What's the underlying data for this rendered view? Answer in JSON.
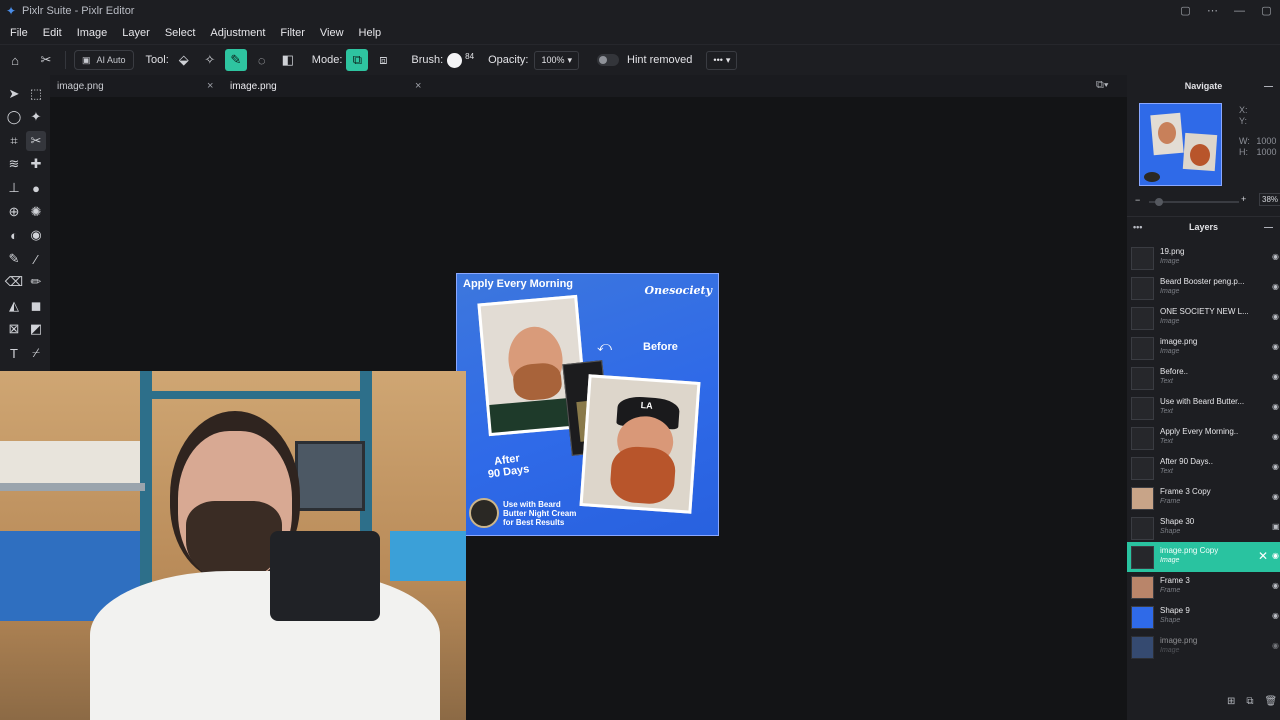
{
  "window": {
    "title": "Pixlr Suite - Pixlr Editor"
  },
  "menu": [
    "File",
    "Edit",
    "Image",
    "Layer",
    "Select",
    "Adjustment",
    "Filter",
    "View",
    "Help"
  ],
  "toolbar": {
    "ai_auto": "AI Auto",
    "tool_label": "Tool:",
    "mode_label": "Mode:",
    "brush_label": "Brush:",
    "brush_size": "84",
    "opacity_label": "Opacity:",
    "opacity_value": "100%",
    "hint_label": "Hint removed",
    "more": "•••"
  },
  "tabs": [
    {
      "label": "image.png",
      "close": "×"
    },
    {
      "label": "image.png",
      "close": "×"
    }
  ],
  "canvas": {
    "title": "Apply Every Morning",
    "brand": "Onesociety",
    "before": "Before",
    "after": "After\n90 Days",
    "use": "Use with Beard Butter Night Cream for Best Results"
  },
  "navigate": {
    "title": "Navigate",
    "x_label": "X:",
    "y_label": "Y:",
    "w_label": "W:",
    "w_value": "1000",
    "h_label": "H:",
    "h_value": "1000",
    "zoom": "38%",
    "zoom_minus": "−",
    "zoom_plus": "+"
  },
  "layers": {
    "title": "Layers",
    "menu": "•••",
    "items": [
      {
        "name": "19.png",
        "type": "Image"
      },
      {
        "name": "Beard Booster peng.p...",
        "type": "Image"
      },
      {
        "name": "ONE SOCIETY NEW L...",
        "type": "Image"
      },
      {
        "name": "image.png",
        "type": "Image"
      },
      {
        "name": "Before..",
        "type": "Text"
      },
      {
        "name": "Use with Beard Butter...",
        "type": "Text"
      },
      {
        "name": "Apply Every Morning..",
        "type": "Text"
      },
      {
        "name": "After 90 Days..",
        "type": "Text"
      },
      {
        "name": "Frame 3 Copy",
        "type": "Frame"
      },
      {
        "name": "Shape 30",
        "type": "Shape"
      },
      {
        "name": "image.png Copy",
        "type": "Image"
      },
      {
        "name": "Frame 3",
        "type": "Frame"
      },
      {
        "name": "Shape 9",
        "type": "Shape"
      },
      {
        "name": "image.png",
        "type": "Image"
      }
    ]
  },
  "colors": {
    "accent": "#29c3a0",
    "canvas_blue": "#2f6ae8"
  }
}
